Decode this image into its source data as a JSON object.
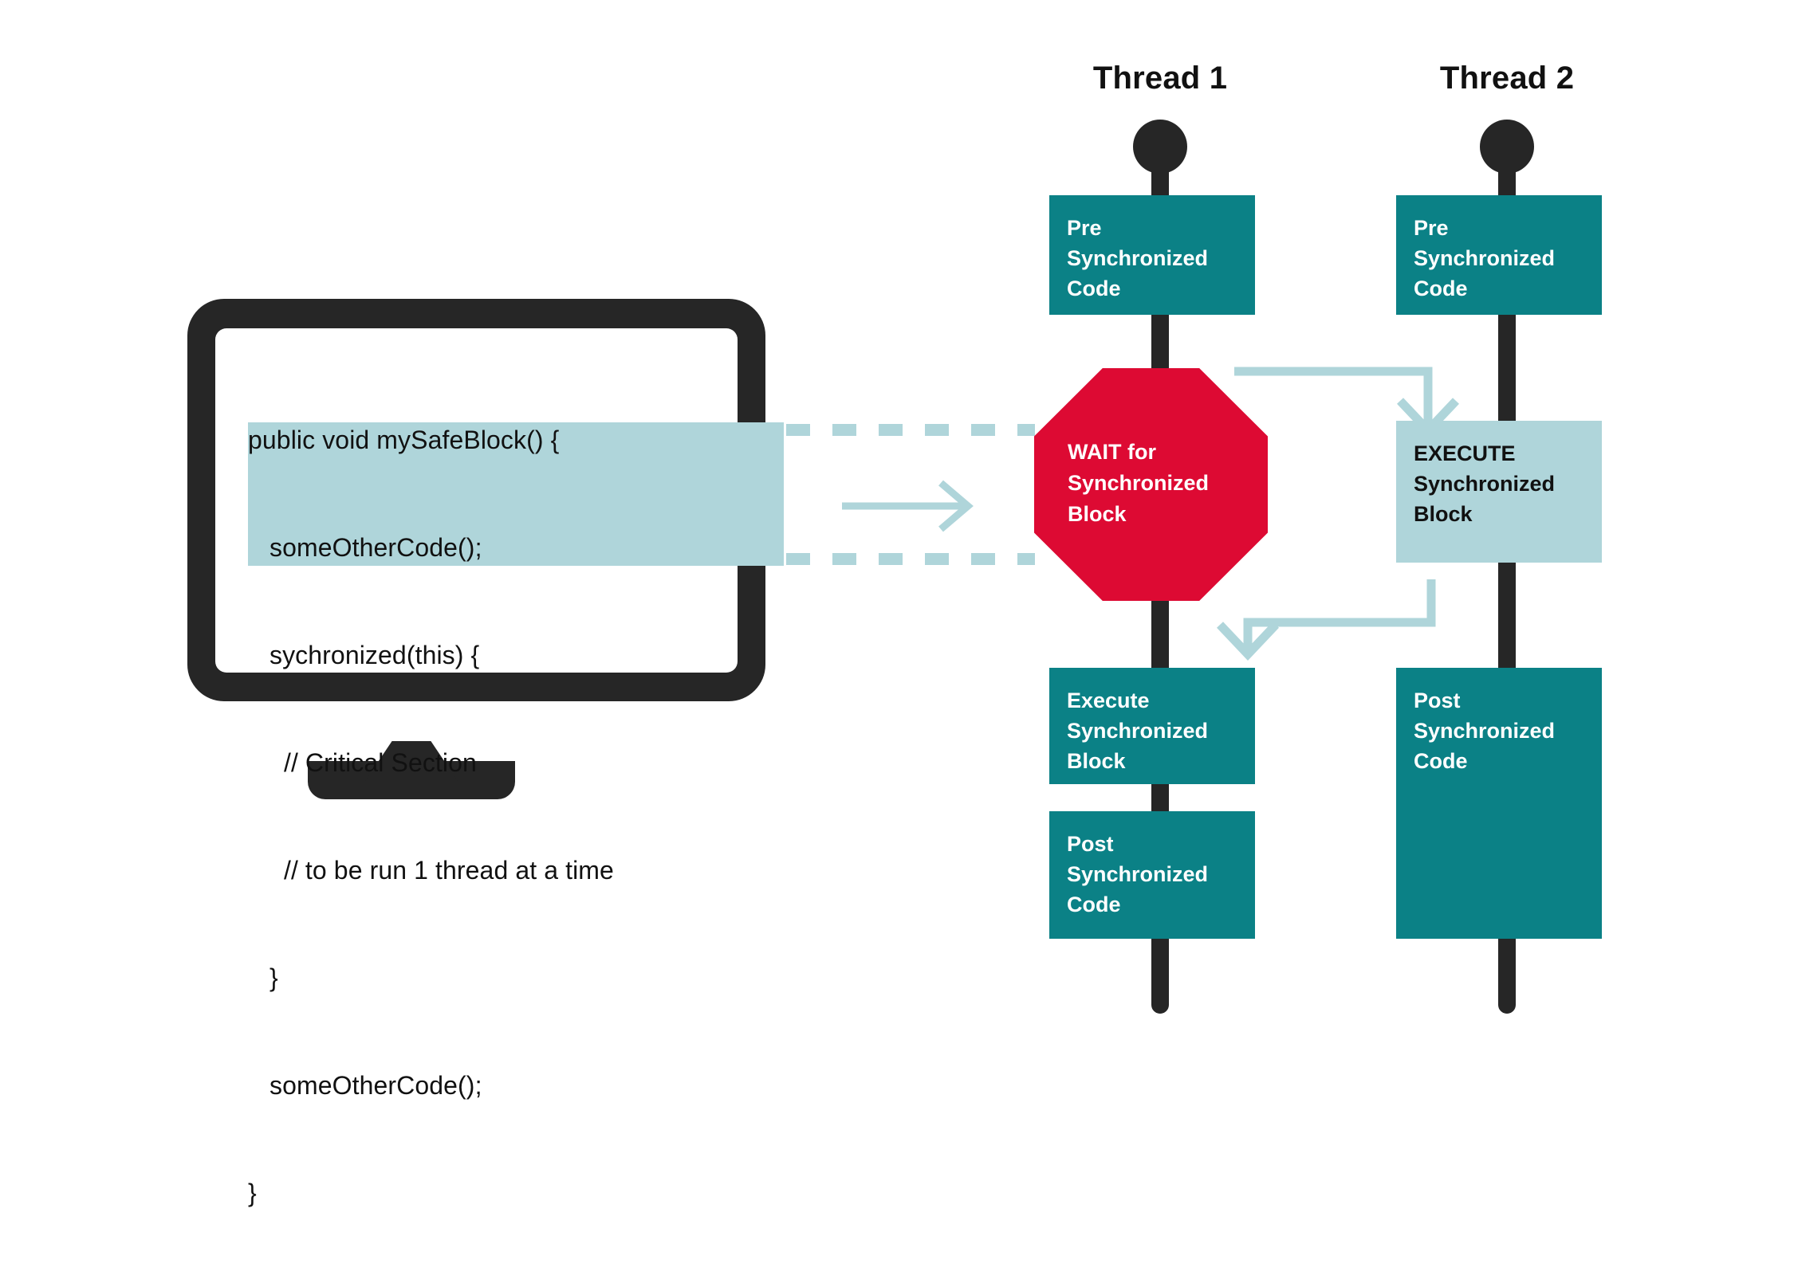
{
  "diagram": {
    "title": "Java synchronized block thread execution diagram",
    "colors": {
      "teal": "#0B8186",
      "light_teal": "#AFD5DA",
      "red": "#DD0A33",
      "dark": "#262626",
      "background": "#FFFFFF"
    }
  },
  "monitor": {
    "code_lines": [
      "public void mySafeBlock() {",
      "   someOtherCode();",
      "   sychronized(this) {",
      "     // Critical Section",
      "     // to be run 1 thread at a time",
      "   }",
      "   someOtherCode();",
      "}"
    ],
    "highlighted_line_indices": [
      2,
      3,
      4,
      5
    ]
  },
  "threads": [
    {
      "id": "thread-1",
      "title": "Thread 1",
      "steps": [
        {
          "kind": "box",
          "style": "teal",
          "label": "Pre\nSynchronized\nCode"
        },
        {
          "kind": "octagon",
          "style": "red",
          "label": "WAIT for\nSynchronized\nBlock"
        },
        {
          "kind": "box",
          "style": "teal",
          "label": "Execute\nSynchronized\nBlock"
        },
        {
          "kind": "box",
          "style": "teal",
          "label": "Post\nSynchronized\nCode"
        }
      ]
    },
    {
      "id": "thread-2",
      "title": "Thread 2",
      "steps": [
        {
          "kind": "box",
          "style": "teal",
          "label": "Pre\nSynchronized\nCode"
        },
        {
          "kind": "box",
          "style": "light",
          "label": "EXECUTE\nSynchronized\nBlock"
        },
        {
          "kind": "box",
          "style": "teal",
          "label": "Post\nSynchronized\nCode"
        }
      ]
    }
  ],
  "connectors": {
    "code_to_diagram_arrow": "right-arrow-icon",
    "dashed_top": "dashed-connector-top",
    "dashed_bottom": "dashed-connector-bottom",
    "elbow_top": "elbow-arrow-wait-to-execute",
    "elbow_bottom": "elbow-arrow-execute-to-run"
  },
  "labels": {
    "t1_pre": "Pre\nSynchronized\nCode",
    "t1_wait": "WAIT for\nSynchronized\nBlock",
    "t1_exec": "Execute\nSynchronized\nBlock",
    "t1_post": "Post\nSynchronized\nCode",
    "t2_pre": "Pre\nSynchronized\nCode",
    "t2_exec": "EXECUTE\nSynchronized\nBlock",
    "t2_post": "Post\nSynchronized\nCode",
    "t1_title": "Thread 1",
    "t2_title": "Thread 2"
  },
  "code": {
    "l0": "public void mySafeBlock() {",
    "l1": "   someOtherCode();",
    "l2": "   sychronized(this) {",
    "l3": "     // Critical Section",
    "l4": "     // to be run 1 thread at a time",
    "l5": "   }",
    "l6": "   someOtherCode();",
    "l7": "}"
  }
}
